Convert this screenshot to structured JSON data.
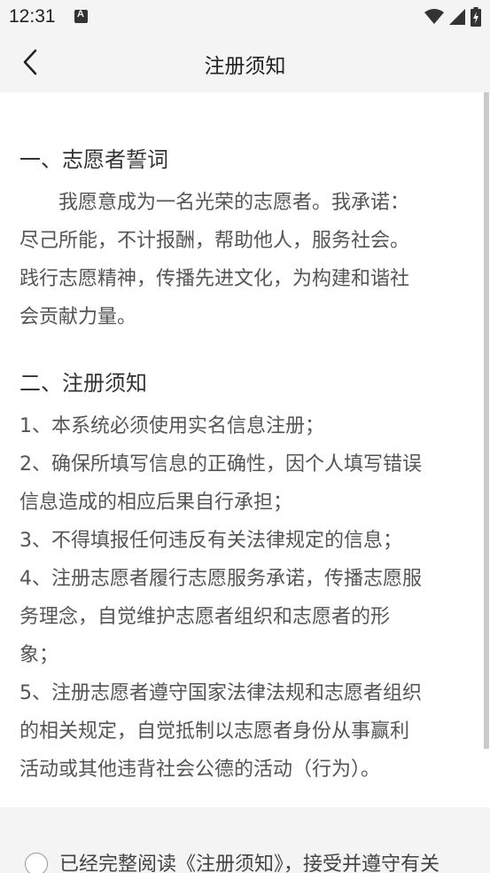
{
  "status_bar": {
    "time": "12:31",
    "icons": [
      "notification-a-icon",
      "wifi-icon",
      "signal-icon",
      "battery-charging-icon"
    ]
  },
  "header": {
    "title": "注册须知",
    "back_icon": "chevron-left-icon"
  },
  "pledge": {
    "heading": "一、志愿者誓词",
    "lines": [
      "　　我愿意成为一名光荣的志愿者。我承诺：",
      "尽己所能，不计报酬，帮助他人，服务社会。",
      "践行志愿精神，传播先进文化，为构建和谐社",
      "会贡献力量。"
    ]
  },
  "notice": {
    "heading": "二、注册须知",
    "lines": [
      "1、本系统必须使用实名信息注册；",
      "2、确保所填写信息的正确性，因个人填写错误",
      "信息造成的相应后果自行承担；",
      "3、不得填报任何违反有关法律规定的信息；",
      "4、注册志愿者履行志愿服务承诺，传播志愿服",
      "务理念，自觉维护志愿者组织和志愿者的形",
      "象；",
      "5、注册志愿者遵守国家法律法规和志愿者组织",
      "的相关规定，自觉抵制以志愿者身份从事赢利",
      "活动或其他违背社会公德的活动（行为）。"
    ]
  },
  "agreement": {
    "text": "已经完整阅读《注册须知》，接受并遵守有关"
  }
}
